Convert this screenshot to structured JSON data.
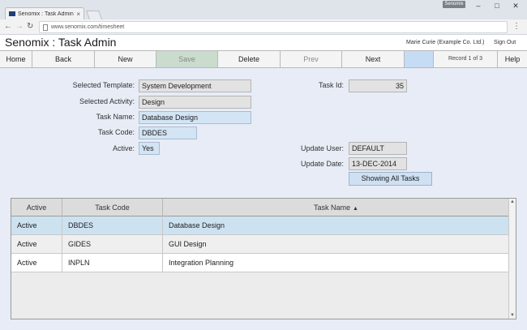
{
  "browser": {
    "tab_title": "Senomix : Task Administr...",
    "tab_close": "×",
    "profile_label": "Senomix",
    "url": "www.senomix.com/timesheet",
    "icons": {
      "back": "arrow-left-icon",
      "forward": "arrow-right-icon",
      "reload": "reload-icon",
      "menu": "menu-icon",
      "minimize": "minimize-icon",
      "maximize": "maximize-icon",
      "close": "close-icon"
    }
  },
  "header": {
    "title": "Senomix : Task Admin",
    "user": "Marie Curie  (Example Co. Ltd.)",
    "signout": "Sign Out"
  },
  "toolbar": {
    "home": "Home",
    "back": "Back",
    "new": "New",
    "save": "Save",
    "delete": "Delete",
    "prev": "Prev",
    "next": "Next",
    "record": "Record 1 of 3",
    "help": "Help"
  },
  "form": {
    "selected_template_label": "Selected Template:",
    "selected_template_value": "System Development",
    "selected_activity_label": "Selected Activity:",
    "selected_activity_value": "Design",
    "task_name_label": "Task Name:",
    "task_name_value": "Database Design",
    "task_code_label": "Task Code:",
    "task_code_value": "DBDES",
    "active_label": "Active:",
    "active_value": "Yes",
    "task_id_label": "Task Id:",
    "task_id_value": "35",
    "update_user_label": "Update User:",
    "update_user_value": "DEFAULT",
    "update_date_label": "Update Date:",
    "update_date_value": "13-DEC-2014",
    "show_all_button": "Showing All Tasks"
  },
  "grid": {
    "columns": [
      "Active",
      "Task Code",
      "Task Name"
    ],
    "sort_indicator": "▲",
    "rows": [
      {
        "active": "Active",
        "code": "DBDES",
        "name": "Database Design"
      },
      {
        "active": "Active",
        "code": "GIDES",
        "name": "GUI Design"
      },
      {
        "active": "Active",
        "code": "INPLN",
        "name": "Integration Planning"
      }
    ]
  },
  "colors": {
    "content_bg": "#e7ecf6",
    "selected_row": "#cde2f1",
    "editable_field": "#d3e4f4",
    "save_button": "#c9dccd"
  }
}
